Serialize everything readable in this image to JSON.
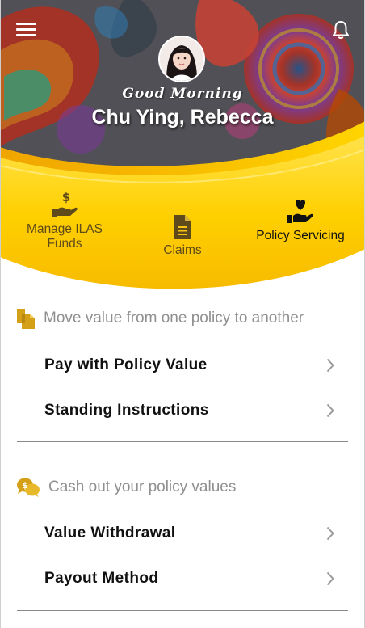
{
  "header": {
    "greeting": "Good Morning",
    "user_name": "Chu Ying, Rebecca",
    "menu_icon": "hamburger-menu-icon",
    "notification_icon": "bell-icon"
  },
  "quick_nav": [
    {
      "label": "Manage ILAS Funds",
      "icon": "hand-dollar-icon"
    },
    {
      "label": "Claims",
      "icon": "document-icon"
    },
    {
      "label": "Policy Servicing",
      "icon": "hand-heart-icon",
      "active": true
    }
  ],
  "sections": [
    {
      "title": "Move value from one policy to another",
      "icon": "copy-documents-icon",
      "items": [
        {
          "label": "Pay with Policy Value"
        },
        {
          "label": "Standing Instructions"
        }
      ]
    },
    {
      "title": "Cash out your policy values",
      "icon": "chat-dollar-icon",
      "items": [
        {
          "label": "Value Withdrawal"
        },
        {
          "label": "Payout Method"
        }
      ]
    }
  ],
  "colors": {
    "accent_yellow": "#f7c511",
    "accent_gold": "#d4a017",
    "text_dark": "#111111",
    "text_muted": "#8f8f8f"
  }
}
